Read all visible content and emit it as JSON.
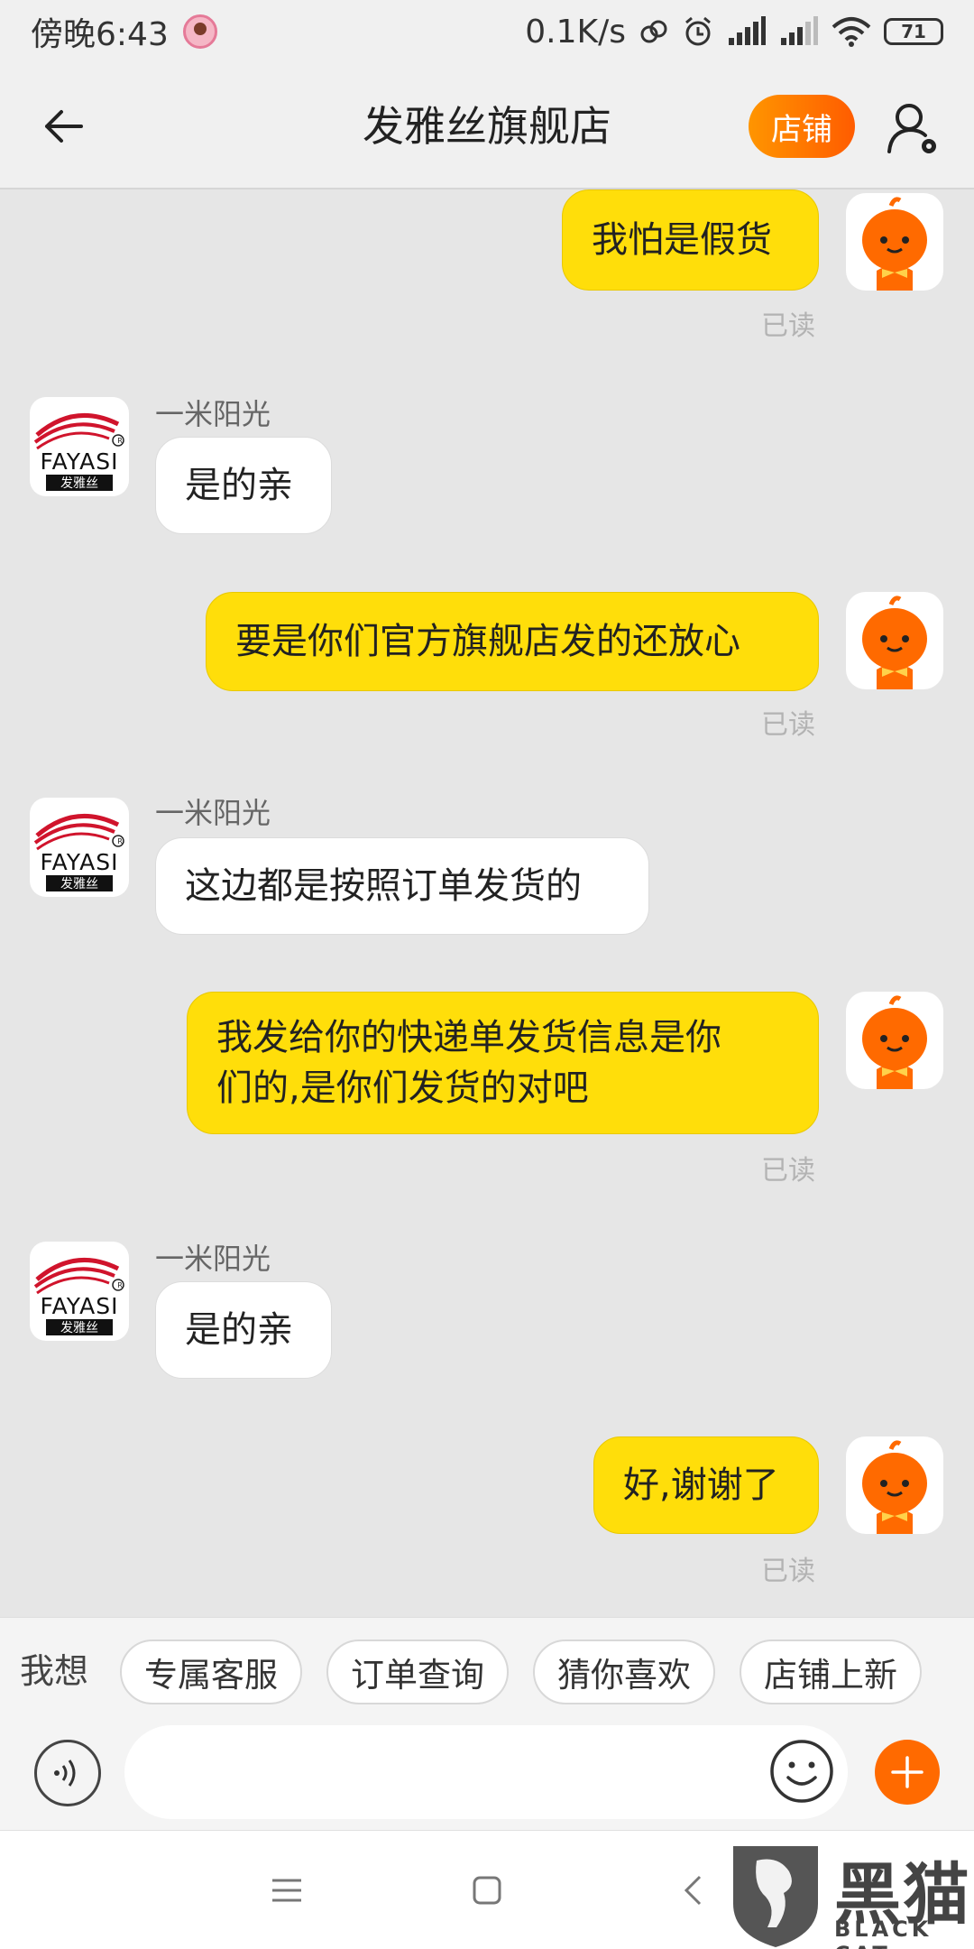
{
  "status_bar": {
    "time": "傍晚6:43",
    "network_speed": "0.1K/s",
    "battery": "71"
  },
  "header": {
    "title": "发雅丝旗舰店",
    "shop_button": "店铺"
  },
  "messages": [
    {
      "from": "me",
      "text": "我怕是假货",
      "status": "已读"
    },
    {
      "from": "shop",
      "sender": "一米阳光",
      "text": "是的亲"
    },
    {
      "from": "me",
      "text": "要是你们官方旗舰店发的还放心",
      "status": "已读"
    },
    {
      "from": "shop",
      "sender": "一米阳光",
      "text": "这边都是按照订单发货的"
    },
    {
      "from": "me",
      "text_line1": "我发给你的快递单发货信息是你",
      "text_line2": "们的,是你们发货的对吧",
      "status": "已读"
    },
    {
      "from": "shop",
      "sender": "一米阳光",
      "text": "是的亲"
    },
    {
      "from": "me",
      "text": "好,谢谢了",
      "status": "已读"
    }
  ],
  "shop_logo": {
    "brand": "FAYASI",
    "brand_cn": "发雅丝",
    "mark": "R"
  },
  "quick_replies": {
    "label": "我想",
    "chips": [
      "专属客服",
      "订单查询",
      "猜你喜欢",
      "店铺上新"
    ]
  },
  "input": {
    "placeholder": ""
  },
  "watermark": {
    "text": "黑猫",
    "sub": "BLACK CAT"
  },
  "colors": {
    "my_bubble": "#ffde0a",
    "shop_button": "#ff6a00",
    "background": "#e6e6e6"
  }
}
